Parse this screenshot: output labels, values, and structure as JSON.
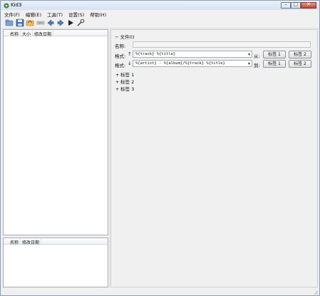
{
  "window": {
    "title": "Kid3"
  },
  "menubar": {
    "items": [
      "文件(F)",
      "编辑(E)",
      "工具(T)",
      "设置(S)",
      "帮助(H)"
    ]
  },
  "toolbar": {
    "icons": [
      "open-folder-icon",
      "save-icon",
      "revert-icon",
      "rename-icon",
      "previous-icon",
      "next-icon",
      "play-icon",
      "settings-icon"
    ]
  },
  "file_list": {
    "columns": [
      "名称",
      "大小",
      "修改日期"
    ]
  },
  "dir_list": {
    "columns": [
      "名称",
      "修改日期"
    ]
  },
  "file_section": {
    "header": "− 文件(I)",
    "name_label": "名称:",
    "format_label_1": "格式:",
    "format_label_2": "格式:",
    "format_value_1": "%{track} %{title}",
    "format_value_2": "%{artist} - %{album}/%{track} %{title}",
    "from_label": "从:",
    "to_label": "到:",
    "btn_tag1_a": "标签 1",
    "btn_tag2_a": "标签 2",
    "btn_tag1_b": "标签 1",
    "btn_tag2_b": "标签 2",
    "arrow_up": "↑",
    "arrow_down": "↓",
    "combo_arrow": "▾"
  },
  "tags": [
    {
      "bullet": "+",
      "label": "标签 1"
    },
    {
      "bullet": "+",
      "label": "标签 2"
    },
    {
      "bullet": "+",
      "label": "标签 3"
    }
  ],
  "window_buttons": {
    "minimize": "–",
    "maximize": "□",
    "close": "✕"
  }
}
